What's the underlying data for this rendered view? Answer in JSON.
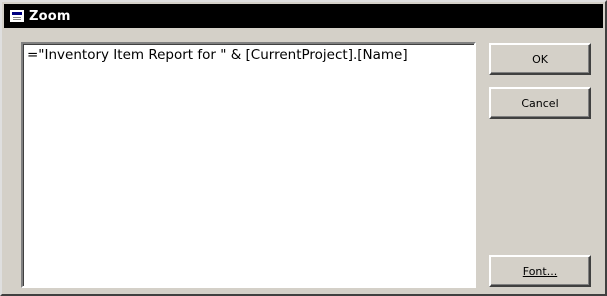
{
  "window": {
    "title": "Zoom"
  },
  "editor": {
    "value": "=\"Inventory Item Report for \" & [CurrentProject].[Name]"
  },
  "buttons": {
    "ok_label": "OK",
    "cancel_label": "Cancel",
    "font_label": "Font..."
  },
  "icons": {
    "title_icon": "form-window-icon"
  },
  "colors": {
    "titlebar": "#000000",
    "dialog_face": "#d4d0c8",
    "text_area": "#ffffff"
  }
}
